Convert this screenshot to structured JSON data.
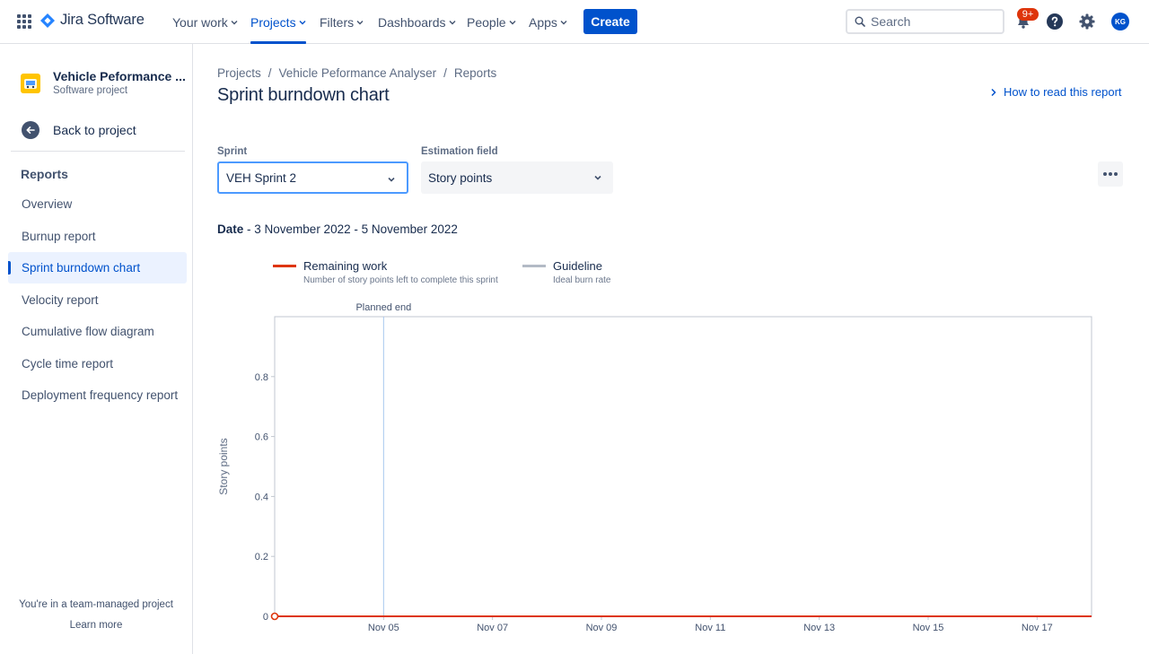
{
  "nav": {
    "logo_text": "Jira Software",
    "items": [
      {
        "label": "Your work"
      },
      {
        "label": "Projects"
      },
      {
        "label": "Filters"
      },
      {
        "label": "Dashboards"
      },
      {
        "label": "People"
      },
      {
        "label": "Apps"
      }
    ],
    "active_item": "Projects",
    "create_label": "Create",
    "search_placeholder": "Search",
    "notifications_badge": "9+",
    "avatar_initials": "KG"
  },
  "sidebar": {
    "project_name": "Vehicle Peformance ...",
    "project_type": "Software project",
    "back_label": "Back to project",
    "section_heading": "Reports",
    "items": [
      {
        "label": "Overview"
      },
      {
        "label": "Burnup report"
      },
      {
        "label": "Sprint burndown chart"
      },
      {
        "label": "Velocity report"
      },
      {
        "label": "Cumulative flow diagram"
      },
      {
        "label": "Cycle time report"
      },
      {
        "label": "Deployment frequency report"
      }
    ],
    "active_item": "Sprint burndown chart",
    "team_note": "You're in a team-managed project",
    "learn_more": "Learn more"
  },
  "main": {
    "breadcrumbs": [
      "Projects",
      "Vehicle Peformance Analyser",
      "Reports"
    ],
    "title": "Sprint burndown chart",
    "how_to_read": "How to read this report",
    "sprint_label": "Sprint",
    "sprint_value": "VEH Sprint 2",
    "estimation_label": "Estimation field",
    "estimation_value": "Story points",
    "date_label": "Date",
    "date_value": "- 3 November 2022 - 5 November 2022"
  },
  "legend": [
    {
      "name": "Remaining work",
      "desc": "Number of story points left to complete this sprint",
      "color": "#DE350B"
    },
    {
      "name": "Guideline",
      "desc": "Ideal burn rate",
      "color": "#B3BAC5"
    }
  ],
  "colors": {
    "accent": "#0052CC",
    "remaining": "#DE350B",
    "guideline_marker": "#A8C8F0"
  },
  "chart_data": {
    "type": "line",
    "ylabel": "Story points",
    "ylim": [
      0,
      1
    ],
    "yticks": [
      0,
      0.2,
      0.4,
      0.6,
      0.8
    ],
    "xlim": [
      "2022-11-03",
      "2022-11-18"
    ],
    "xtick_labels": [
      "Nov 05",
      "Nov 07",
      "Nov 09",
      "Nov 11",
      "Nov 13",
      "Nov 15",
      "Nov 17"
    ],
    "xtick_dates": [
      "2022-11-05",
      "2022-11-07",
      "2022-11-09",
      "2022-11-11",
      "2022-11-13",
      "2022-11-15",
      "2022-11-17"
    ],
    "annotation": {
      "label": "Planned end",
      "date": "2022-11-05"
    },
    "series": [
      {
        "name": "Remaining work",
        "points": [
          {
            "x": "2022-11-03",
            "y": 0
          },
          {
            "x": "2022-11-18",
            "y": 0
          }
        ]
      }
    ]
  }
}
